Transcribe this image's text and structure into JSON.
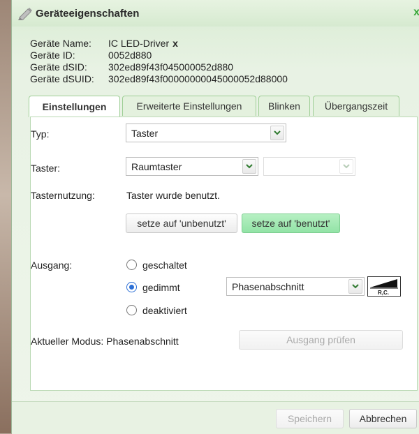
{
  "window": {
    "title": "Geräteeigenschaften",
    "close_glyph": "x"
  },
  "device": {
    "name_label": "Geräte Name:",
    "name_value": "IC LED-Driver",
    "name_edit_glyph": "x",
    "id_label": "Geräte ID:",
    "id_value": "0052d880",
    "dsid_label": "Geräte dSID:",
    "dsid_value": "302ed89f43f045000052d880",
    "dsuid_label": "Geräte dSUID:",
    "dsuid_value": "302ed89f43f00000000045000052d88000"
  },
  "tabs": [
    {
      "label": "Einstellungen",
      "active": true
    },
    {
      "label": "Erweiterte Einstellungen",
      "active": false
    },
    {
      "label": "Blinken",
      "active": false
    },
    {
      "label": "Übergangszeit",
      "active": false
    }
  ],
  "settings": {
    "typ_label": "Typ:",
    "typ_value": "Taster",
    "taster_label": "Taster:",
    "taster_value": "Raumtaster",
    "taster_secondary_value": "",
    "usage_label": "Tasternutzung:",
    "usage_text": "Taster wurde benutzt.",
    "btn_unused": "setze auf 'unbenutzt'",
    "btn_used": "setze auf 'benutzt'",
    "output_label": "Ausgang:",
    "output_options": [
      {
        "label": "geschaltet",
        "checked": false
      },
      {
        "label": "gedimmt",
        "checked": true
      },
      {
        "label": "deaktiviert",
        "checked": false
      }
    ],
    "dimming_mode": "Phasenabschnitt",
    "dimming_icon_text": "R,C.",
    "current_mode_text": "Aktueller Modus: Phasenabschnitt",
    "btn_check_output": "Ausgang prüfen"
  },
  "footer": {
    "save": "Speichern",
    "cancel": "Abbrechen"
  },
  "colors": {
    "accent_green": "#92e3a6",
    "radio_selected": "#2b6fd6",
    "tab_border": "#9fcf96"
  }
}
